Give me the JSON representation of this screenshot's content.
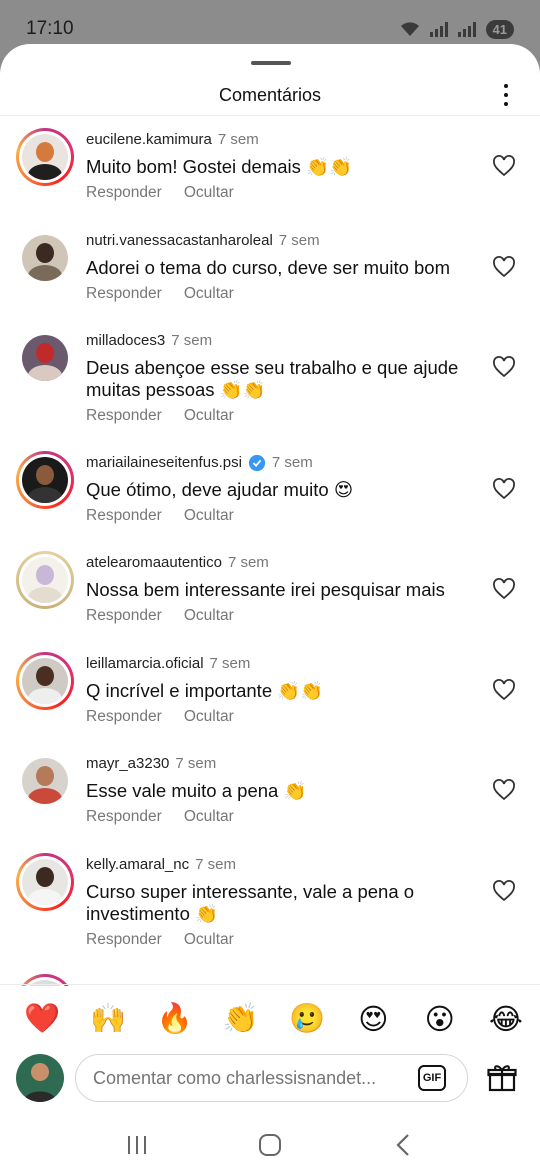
{
  "status_bar": {
    "time": "17:10",
    "battery": "41"
  },
  "sheet": {
    "title": "Comentários"
  },
  "comments": [
    {
      "user": "eucilene.kamimura",
      "time": "7 sem",
      "text": "Muito bom! Gostei demais 👏👏",
      "verified": false
    },
    {
      "user": "nutri.vanessacastanharoleal",
      "time": "7 sem",
      "text": "Adorei o tema do curso, deve ser muito bom",
      "verified": false
    },
    {
      "user": "milladoces3",
      "time": "7 sem",
      "text": "Deus abençoe esse seu trabalho e que ajude muitas pessoas 👏👏",
      "verified": false
    },
    {
      "user": "mariailaineseitenfus.psi",
      "time": "7 sem",
      "text": "Que ótimo, deve ajudar muito 😍",
      "verified": true
    },
    {
      "user": "atelearomaautentico",
      "time": "7 sem",
      "text": "Nossa bem interessante irei pesquisar mais",
      "verified": false
    },
    {
      "user": "leillamarcia.oficial",
      "time": "7 sem",
      "text": "Q incrível e importante 👏👏",
      "verified": false
    },
    {
      "user": "mayr_a3230",
      "time": "7 sem",
      "text": "Esse vale muito a pena 👏",
      "verified": false
    },
    {
      "user": "kelly.amaral_nc",
      "time": "7 sem",
      "text": "Curso super interessante, vale a pena o investimento 👏",
      "verified": false
    }
  ],
  "actions": {
    "reply": "Responder",
    "hide": "Ocultar"
  },
  "emoji_bar": [
    "❤️",
    "🙌",
    "🔥",
    "👏",
    "🥲",
    "😍",
    "😮",
    "😂"
  ],
  "composer": {
    "placeholder": "Comentar como charlessisnandet...",
    "gif": "GIF"
  },
  "colors": {
    "ring_start": "#c13584",
    "ring_end": "#fcaf45",
    "verified_blue": "#3897f0"
  }
}
